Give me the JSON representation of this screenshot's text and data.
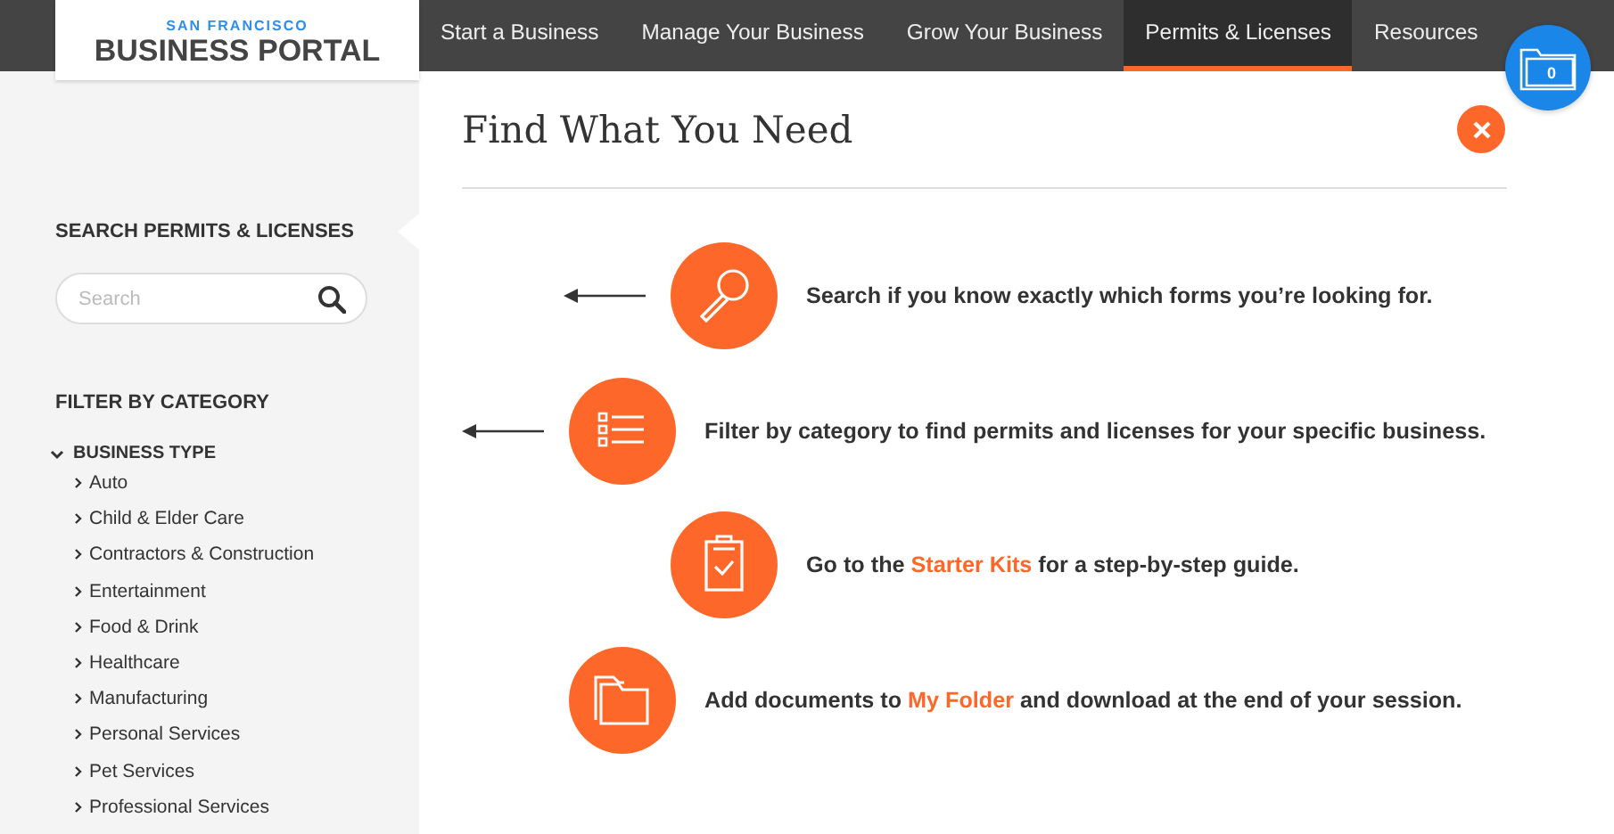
{
  "logo": {
    "city": "SAN FRANCISCO",
    "name": "BUSINESS PORTAL"
  },
  "nav": [
    {
      "label": "Start a Business",
      "selected": false
    },
    {
      "label": "Manage Your Business",
      "selected": false
    },
    {
      "label": "Grow Your Business",
      "selected": false
    },
    {
      "label": "Permits & Licenses",
      "selected": true
    },
    {
      "label": "Resources",
      "selected": false
    }
  ],
  "folder_button": {
    "count": "0"
  },
  "sidebar": {
    "search_heading": "SEARCH PERMITS & LICENSES",
    "search": {
      "placeholder": "Search"
    },
    "filter_heading": "FILTER BY CATEGORY",
    "categories": [
      {
        "label": "BUSINESS TYPE",
        "expanded": true,
        "children": [
          {
            "label": "Auto"
          },
          {
            "label": "Child & Elder Care"
          },
          {
            "label": "Contractors & Construction"
          },
          {
            "label": "Entertainment"
          },
          {
            "label": "Food & Drink"
          },
          {
            "label": "Healthcare"
          },
          {
            "label": "Manufacturing"
          },
          {
            "label": "Personal Services"
          },
          {
            "label": "Pet Services"
          },
          {
            "label": "Professional Services"
          }
        ]
      }
    ]
  },
  "main": {
    "title": "Find What You Need",
    "guide": [
      {
        "kind": "search",
        "arrow": true,
        "text": "Search if you know exactly which forms you’re looking for."
      },
      {
        "kind": "filter",
        "arrow": true,
        "text": "Filter by category to find permits and licenses for your specific business."
      },
      {
        "kind": "kit",
        "arrow": false,
        "before": "Go to the ",
        "link": "Starter Kits",
        "after": " for a step-by-step guide."
      },
      {
        "kind": "folder",
        "arrow": false,
        "before": "Add documents to ",
        "link": "My Folder",
        "after": " and download at the end of your session."
      }
    ]
  }
}
